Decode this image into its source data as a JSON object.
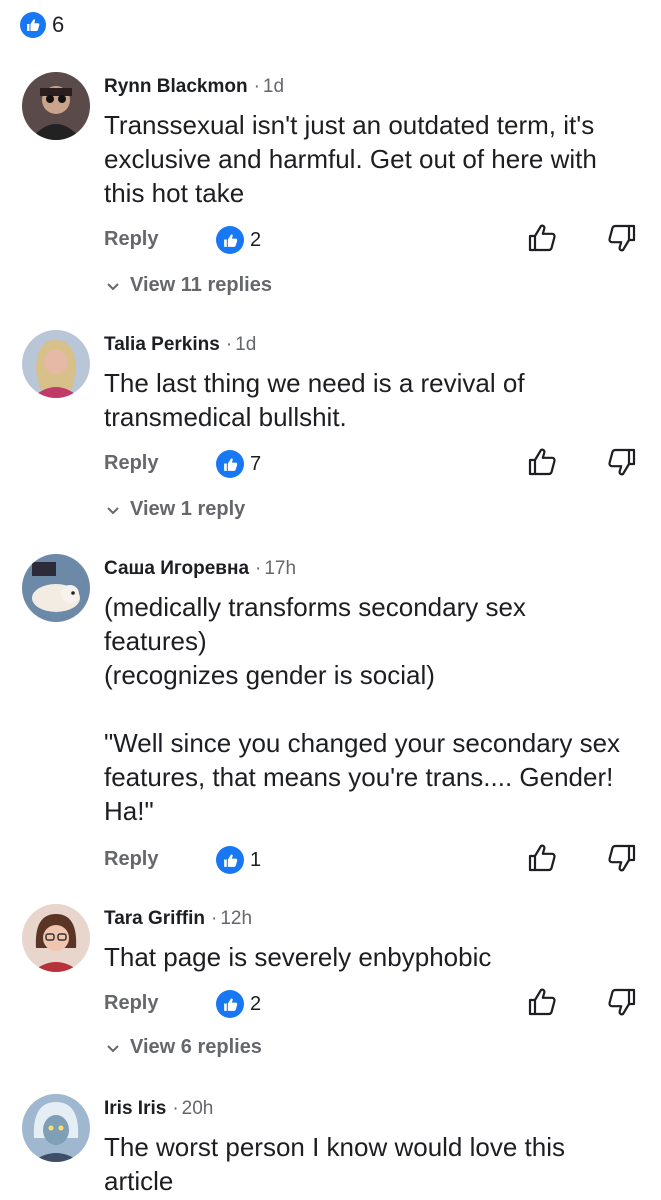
{
  "header": {
    "like_count": "6"
  },
  "comments": [
    {
      "author": "Rynn Blackmon",
      "time": "1d",
      "text": "Transsexual isn't just an outdated term, it's exclusive and harmful. Get out of here with this hot take",
      "reply_label": "Reply",
      "likes": "2",
      "view_replies": "View 11 replies"
    },
    {
      "author": "Talia Perkins",
      "time": "1d",
      "text": "The last thing we need is a revival of transmedical bullshit.",
      "reply_label": "Reply",
      "likes": "7",
      "view_replies": "View 1 reply"
    },
    {
      "author": "Саша Игоревна",
      "time": "17h",
      "text": "(medically transforms secondary sex features)\n(recognizes gender is social)\n\n\"Well since you changed your secondary sex features, that means you're trans.... Gender! Ha!\"",
      "reply_label": "Reply",
      "likes": "1"
    },
    {
      "author": "Tara Griffin",
      "time": "12h",
      "text": "That page is severely enbyphobic",
      "reply_label": "Reply",
      "likes": "2",
      "view_replies": "View 6 replies"
    },
    {
      "author": "Iris Iris",
      "time": "20h",
      "text": "The worst person I know would love this article"
    }
  ],
  "icons": {
    "reaction": "like-icon",
    "thumb_up": "thumbs-up-icon",
    "thumb_down": "thumbs-down-icon",
    "expand": "chevron-down-icon"
  },
  "colors": {
    "accent": "#1877f2",
    "muted": "#65676b",
    "text": "#1c1e21"
  }
}
